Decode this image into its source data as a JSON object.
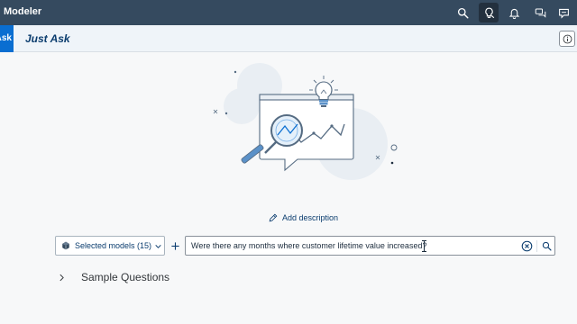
{
  "shell": {
    "app_title": "Modeler",
    "actions": [
      {
        "name": "search-icon"
      },
      {
        "name": "lightbulb-assistant-icon",
        "active": true
      },
      {
        "name": "bell-icon"
      },
      {
        "name": "chat-icon"
      },
      {
        "name": "feedback-icon"
      }
    ]
  },
  "subheader": {
    "tab_label": "Ask",
    "title": "Just Ask",
    "info_icon": "info-icon"
  },
  "illustration": {
    "icons": [
      "magnifier-icon",
      "lightbulb-icon",
      "line-trend-icon"
    ]
  },
  "add_description": {
    "label": "Add description",
    "icon": "pencil-icon"
  },
  "query": {
    "models_label": "Selected models (15)",
    "models_icon": "cube-icon",
    "add_icon": "plus-icon",
    "value": "Were there any months where customer lifetime value increased?",
    "clear_icon": "clear-circle-icon",
    "search_icon": "search-icon"
  },
  "sample_questions": {
    "label": "Sample Questions",
    "icon": "chevron-right-icon"
  },
  "colors": {
    "shell_bg": "#354a5f",
    "accent": "#0a6ed1",
    "title_text": "#0a3c6e",
    "page_bg": "#f7f8f9"
  }
}
